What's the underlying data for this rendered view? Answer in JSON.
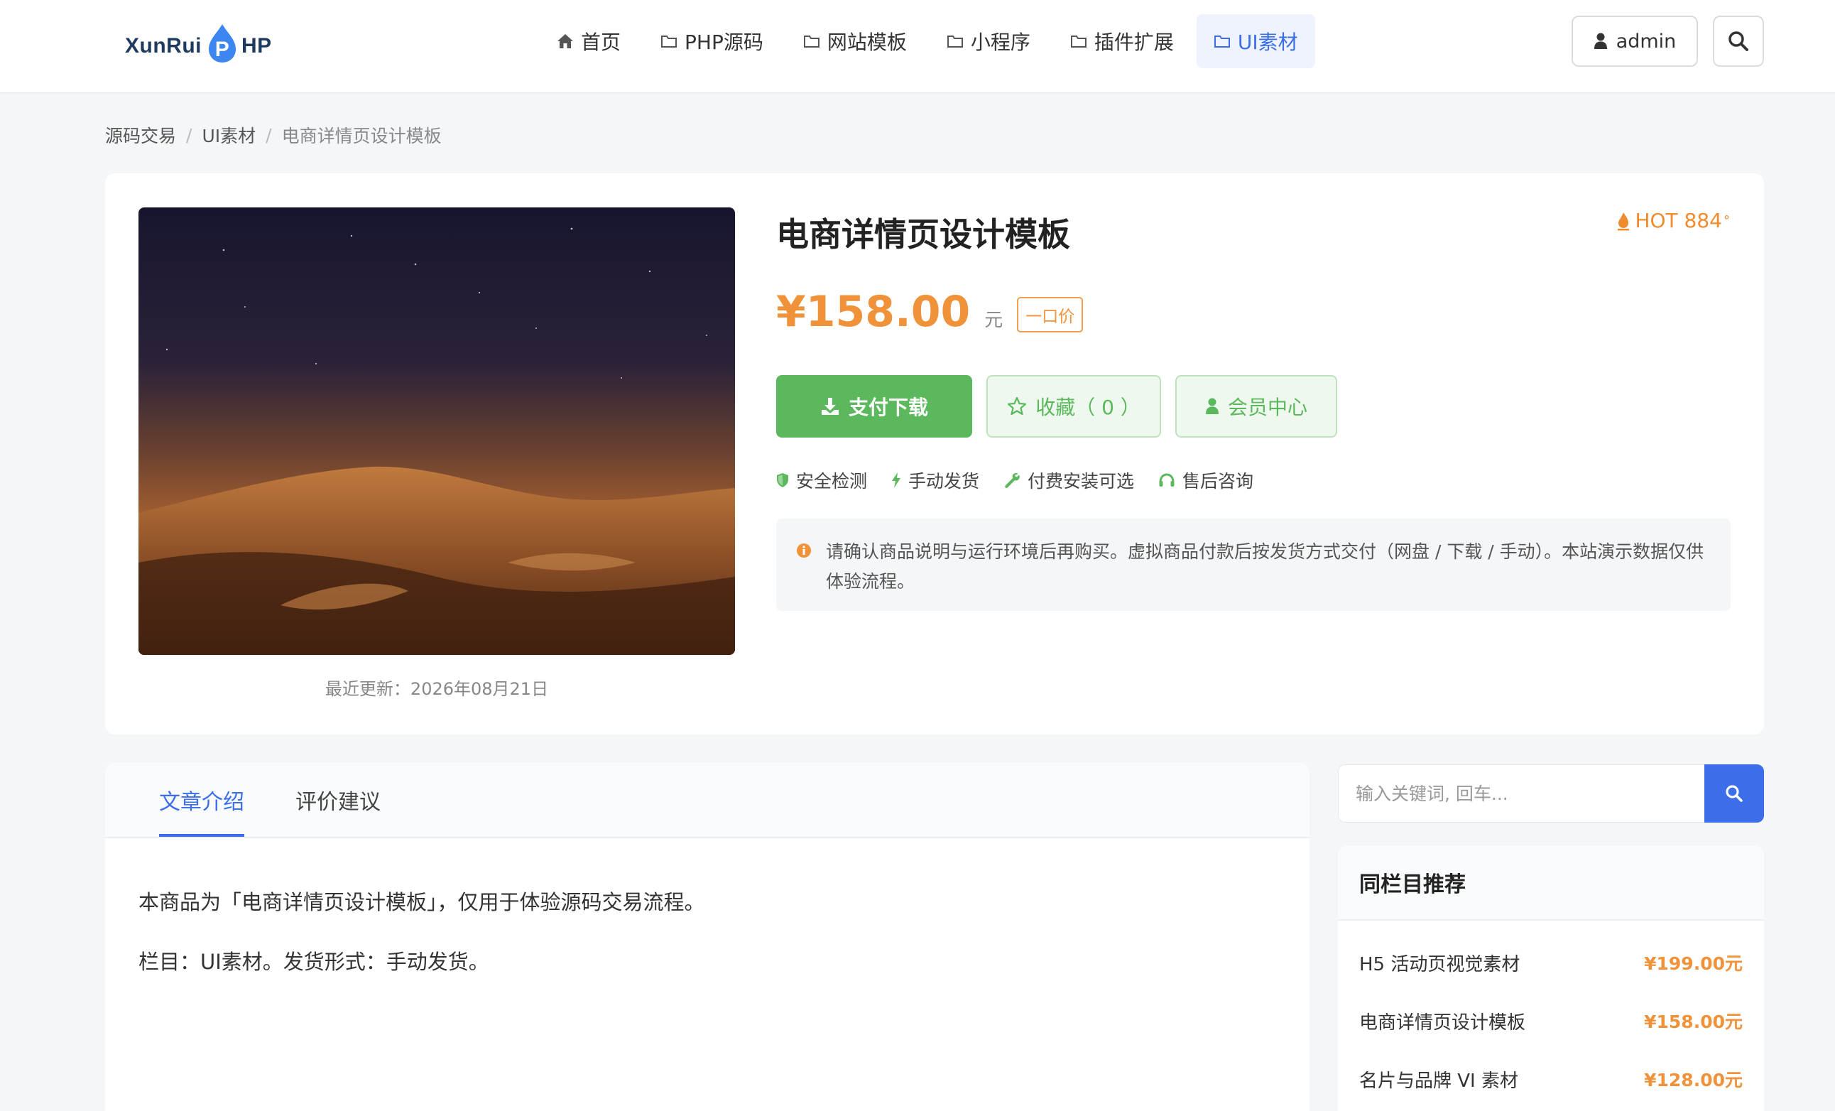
{
  "header": {
    "logo_text_left": "XunRui",
    "logo_badge": "P",
    "logo_text_right": "HP",
    "nav": [
      {
        "label": "首页",
        "icon": "home-icon"
      },
      {
        "label": "PHP源码",
        "icon": "folder-icon"
      },
      {
        "label": "网站模板",
        "icon": "folder-icon"
      },
      {
        "label": "小程序",
        "icon": "folder-icon"
      },
      {
        "label": "插件扩展",
        "icon": "folder-icon"
      },
      {
        "label": "UI素材",
        "icon": "folder-icon",
        "active": true
      }
    ],
    "user_label": "admin"
  },
  "breadcrumb": {
    "items": [
      "源码交易",
      "UI素材",
      "电商详情页设计模板"
    ],
    "separator": "/"
  },
  "product": {
    "title": "电商详情页设计模板",
    "hot_label": "HOT 884",
    "hot_degree": "°",
    "price": "¥158.00",
    "unit": "元",
    "price_tag": "一口价",
    "buttons": {
      "pay": "支付下载",
      "favorite": "收藏（ 0 ）",
      "member": "会员中心"
    },
    "features": [
      {
        "label": "安全检测",
        "icon": "shield-icon"
      },
      {
        "label": "手动发货",
        "icon": "bolt-icon"
      },
      {
        "label": "付费安装可选",
        "icon": "wrench-icon"
      },
      {
        "label": "售后咨询",
        "icon": "headset-icon"
      }
    ],
    "notice": "请确认商品说明与运行环境后再购买。虚拟商品付款后按发货方式交付（网盘 / 下载 / 手动）。本站演示数据仅供体验流程。",
    "update_time": "最近更新：2026年08月21日"
  },
  "tabs": {
    "items": [
      "文章介绍",
      "评价建议"
    ],
    "active": 0
  },
  "article": {
    "paragraphs": [
      "本商品为「电商详情页设计模板」，仅用于体验源码交易流程。",
      "栏目：UI素材。发货形式：手动发货。"
    ]
  },
  "sidebar": {
    "search_placeholder": "输入关键词, 回车...",
    "recommend_title": "同栏目推荐",
    "recommend": [
      {
        "name": "H5 活动页视觉素材",
        "price": "¥199.00元"
      },
      {
        "name": "电商详情页设计模板",
        "price": "¥158.00元"
      },
      {
        "name": "名片与品牌 VI 素材",
        "price": "¥128.00元"
      }
    ]
  },
  "colors": {
    "accent_blue": "#3b6ee8",
    "price_orange": "#f0923a",
    "success_green": "#5cb85c"
  }
}
